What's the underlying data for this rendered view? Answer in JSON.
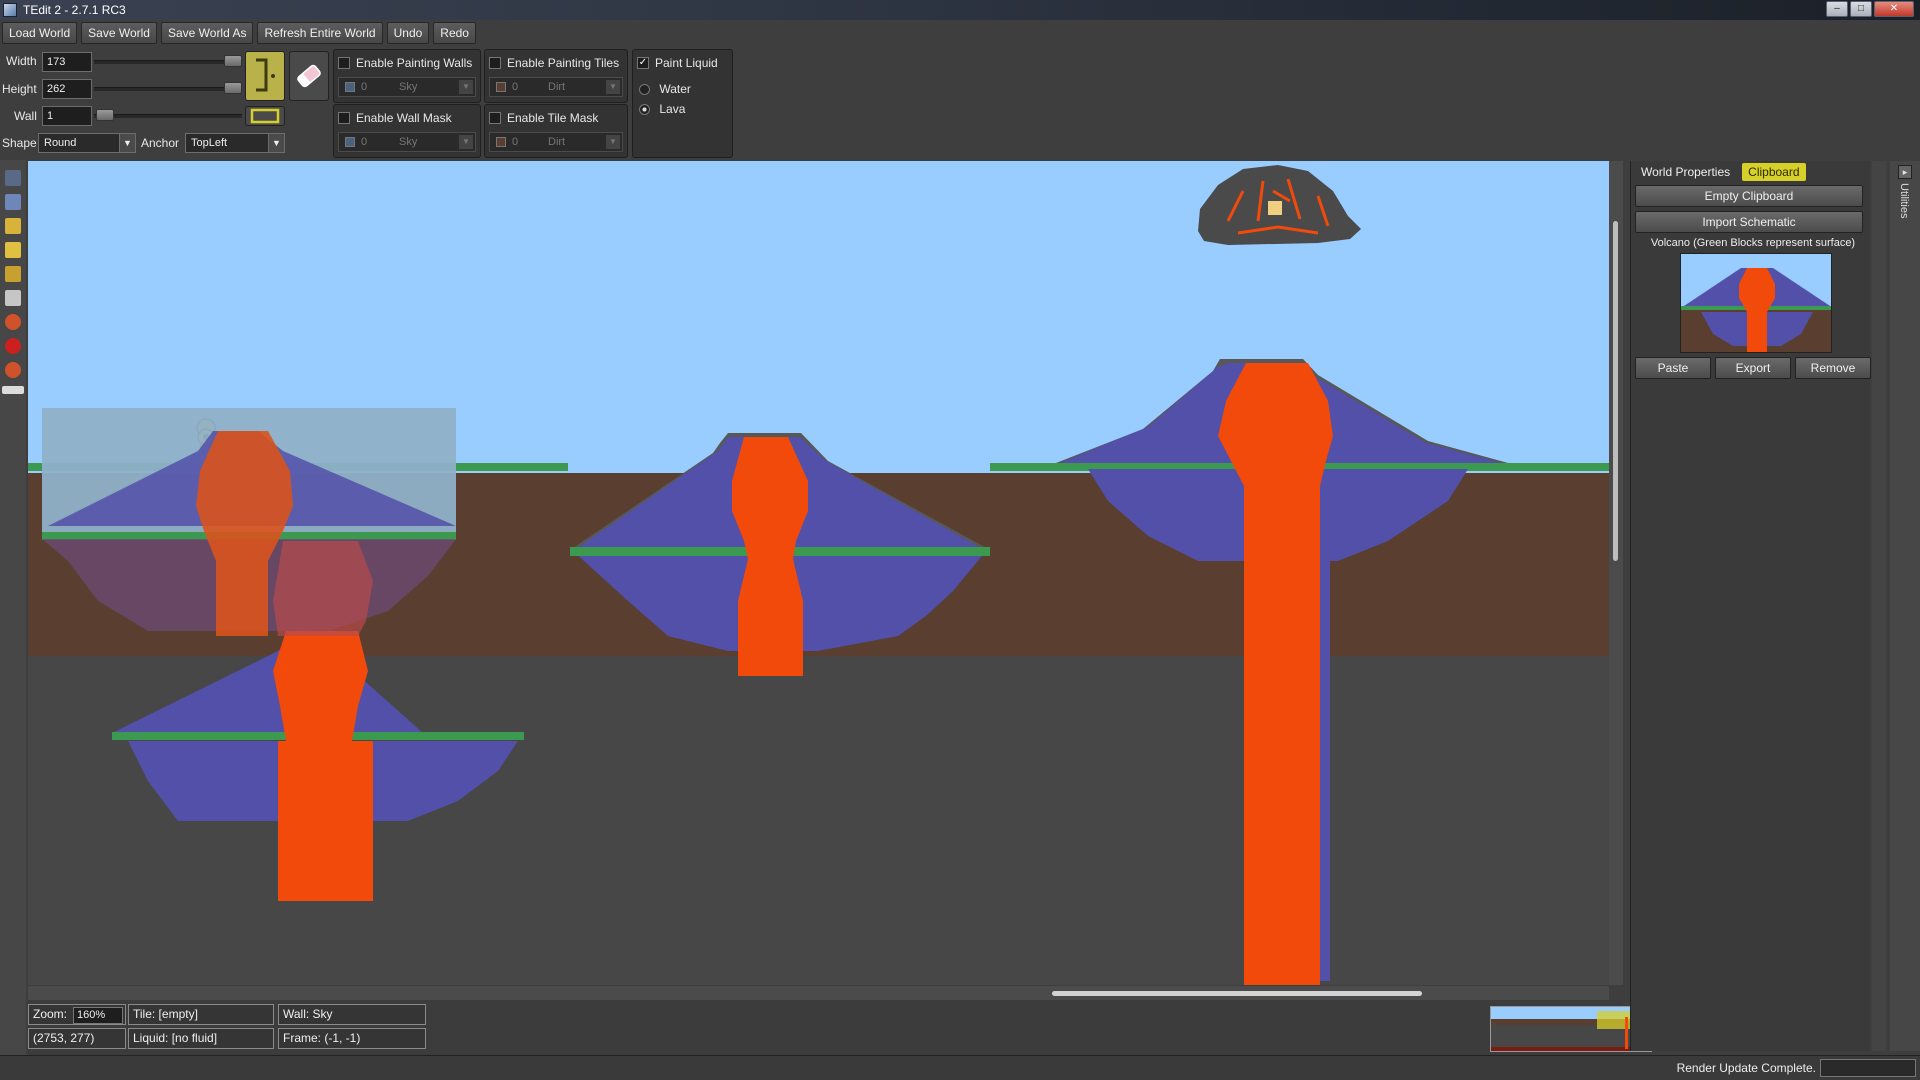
{
  "window": {
    "title": "TEdit 2 - 2.7.1 RC3"
  },
  "toolbar": {
    "load_world": "Load World",
    "save_world": "Save World",
    "save_world_as": "Save World As",
    "refresh_world": "Refresh Entire World",
    "undo": "Undo",
    "redo": "Redo"
  },
  "brush": {
    "width_label": "Width",
    "width_value": "173",
    "height_label": "Height",
    "height_value": "262",
    "wall_label": "Wall",
    "wall_value": "1",
    "shape_label": "Shape",
    "shape_value": "Round",
    "anchor_label": "Anchor",
    "anchor_value": "TopLeft"
  },
  "painting": {
    "walls_label": "Enable Painting Walls",
    "walls_color": "0",
    "walls_value": "Sky",
    "tiles_label": "Enable Painting Tiles",
    "tiles_color": "0",
    "tiles_value": "Dirt",
    "wall_mask_label": "Enable Wall Mask",
    "wall_mask_color": "0",
    "wall_mask_value": "Sky",
    "tile_mask_label": "Enable Tile Mask",
    "tile_mask_color": "0",
    "tile_mask_value": "Dirt"
  },
  "liquid": {
    "paint_label": "Paint Liquid",
    "paint_checked": "✓",
    "water_label": "Water",
    "lava_label": "Lava",
    "selected": "Lava"
  },
  "status": {
    "zoom_label": "Zoom:",
    "zoom_value": "160%",
    "tile": "Tile: [empty]",
    "wall": "Wall: Sky",
    "coords": "(2753, 277)",
    "liquid": "Liquid: [no fluid]",
    "frame": "Frame: (-1, -1)",
    "render": "Render Update Complete."
  },
  "right_panel": {
    "tab_world_properties": "World Properties",
    "tab_clipboard": "Clipboard",
    "empty_clipboard": "Empty Clipboard",
    "import_schematic": "Import Schematic",
    "clip_name": "Volcano (Green Blocks represent surface)",
    "paste": "Paste",
    "export": "Export",
    "remove": "Remove"
  },
  "utilities_tab": "Utilities",
  "colors": {
    "sky": "#99ccff",
    "dirt": "#5a3e30",
    "stone": "#474747",
    "lava": "#f24a0b",
    "ash_wall": "#5250a8",
    "grass": "#3c9a50",
    "accent": "#d8d02a"
  }
}
